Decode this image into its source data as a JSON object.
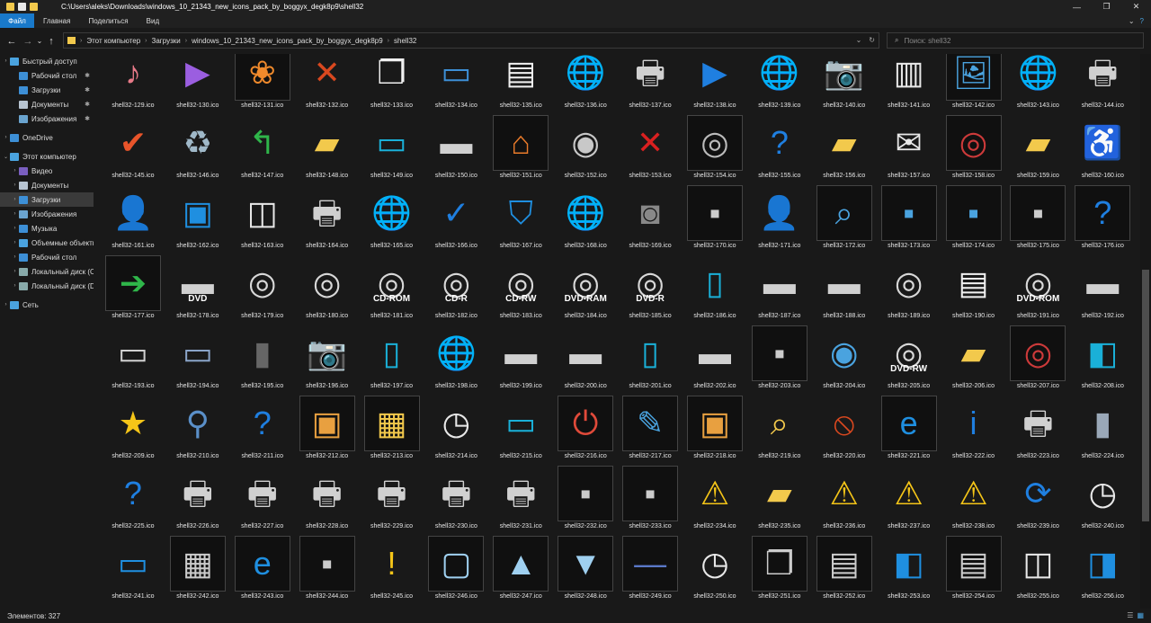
{
  "window": {
    "title": "C:\\Users\\aleks\\Downloads\\windows_10_21343_new_icons_pack_by_boggyx_degk8p9\\shell32",
    "minimize": "—",
    "maximize": "❐",
    "close": "✕"
  },
  "ribbon": {
    "tabs": [
      "Файл",
      "Главная",
      "Поделиться",
      "Вид"
    ],
    "expand": "⌄",
    "help": "?"
  },
  "nav": {
    "back": "←",
    "forward": "→",
    "recent": "⌄",
    "up": "↑",
    "breadcrumb": [
      "Этот компьютер",
      "Загрузки",
      "windows_10_21343_new_icons_pack_by_boggyx_degk8p9",
      "shell32"
    ],
    "refresh": "↻",
    "dropdown": "⌄",
    "search_placeholder": "Поиск: shell32"
  },
  "sidebar": {
    "items": [
      {
        "label": "Быстрый доступ",
        "icon": "star",
        "color": "#4aa3df",
        "indent": 0,
        "expander": "›",
        "pinned": false
      },
      {
        "label": "Рабочий стол",
        "icon": "desktop",
        "color": "#3d8fd6",
        "indent": 1,
        "expander": "",
        "pinned": true
      },
      {
        "label": "Загрузки",
        "icon": "download",
        "color": "#3d8fd6",
        "indent": 1,
        "expander": "",
        "pinned": true
      },
      {
        "label": "Документы",
        "icon": "document",
        "color": "#b7c4d1",
        "indent": 1,
        "expander": "",
        "pinned": true
      },
      {
        "label": "Изображения",
        "icon": "pictures",
        "color": "#6aa4cf",
        "indent": 1,
        "expander": "",
        "pinned": true
      },
      {
        "gap": true
      },
      {
        "label": "OneDrive",
        "icon": "cloud",
        "color": "#3d8fd6",
        "indent": 0,
        "expander": "›",
        "pinned": false
      },
      {
        "gap": true
      },
      {
        "label": "Этот компьютер",
        "icon": "computer",
        "color": "#4aa3df",
        "indent": 0,
        "expander": "⌄",
        "pinned": false
      },
      {
        "label": "Видео",
        "icon": "video",
        "color": "#7a5fc0",
        "indent": 1,
        "expander": "›",
        "pinned": false
      },
      {
        "label": "Документы",
        "icon": "document",
        "color": "#b7c4d1",
        "indent": 1,
        "expander": "›",
        "pinned": false
      },
      {
        "label": "Загрузки",
        "icon": "download",
        "color": "#3d8fd6",
        "indent": 1,
        "expander": "›",
        "pinned": false,
        "selected": true
      },
      {
        "label": "Изображения",
        "icon": "pictures",
        "color": "#6aa4cf",
        "indent": 1,
        "expander": "›",
        "pinned": false
      },
      {
        "label": "Музыка",
        "icon": "music",
        "color": "#3d8fd6",
        "indent": 1,
        "expander": "›",
        "pinned": false
      },
      {
        "label": "Объемные объекты",
        "icon": "3d",
        "color": "#4aa3df",
        "indent": 1,
        "expander": "›",
        "pinned": false
      },
      {
        "label": "Рабочий стол",
        "icon": "desktop",
        "color": "#3d8fd6",
        "indent": 1,
        "expander": "›",
        "pinned": false
      },
      {
        "label": "Локальный диск (C:)",
        "icon": "drive",
        "color": "#8aa",
        "indent": 1,
        "expander": "›",
        "pinned": false
      },
      {
        "label": "Локальный диск (D:)",
        "icon": "drive",
        "color": "#8aa",
        "indent": 1,
        "expander": "›",
        "pinned": false
      },
      {
        "gap": true
      },
      {
        "label": "Сеть",
        "icon": "network",
        "color": "#4aa3df",
        "indent": 0,
        "expander": "›",
        "pinned": false
      }
    ]
  },
  "files": [
    {
      "name": "shell32-129.ico",
      "icon": "music-folder",
      "glyph": "♪",
      "color": "#e77a88"
    },
    {
      "name": "shell32-130.ico",
      "icon": "video-folder",
      "glyph": "▶",
      "color": "#9b5ee0"
    },
    {
      "name": "shell32-131.ico",
      "icon": "butterfly",
      "glyph": "❀",
      "color": "#f08a2c",
      "frame": true
    },
    {
      "name": "shell32-132.ico",
      "icon": "red-x",
      "glyph": "✕",
      "color": "#d9481f"
    },
    {
      "name": "shell32-133.ico",
      "icon": "copy-document",
      "glyph": "❐",
      "color": "#f0f0f0"
    },
    {
      "name": "shell32-134.ico",
      "icon": "text-select",
      "glyph": "▭",
      "color": "#3d8fd6"
    },
    {
      "name": "shell32-135.ico",
      "icon": "documents",
      "glyph": "▤",
      "color": "#f0f0f0"
    },
    {
      "name": "shell32-136.ico",
      "icon": "globe-arrow",
      "glyph": "🌐",
      "color": "#4aa3df"
    },
    {
      "name": "shell32-137.ico",
      "icon": "printer",
      "glyph": "🖶",
      "color": "#d0d0d0"
    },
    {
      "name": "shell32-138.ico",
      "icon": "play",
      "glyph": "▶",
      "color": "#1f7fe0"
    },
    {
      "name": "shell32-139.ico",
      "icon": "globe-music",
      "glyph": "🌐",
      "color": "#4aa3df"
    },
    {
      "name": "shell32-140.ico",
      "icon": "camera",
      "glyph": "📷",
      "color": "#cfcfcf"
    },
    {
      "name": "shell32-141.ico",
      "icon": "projector-screen",
      "glyph": "▥",
      "color": "#e8e8e8"
    },
    {
      "name": "shell32-142.ico",
      "icon": "image-file",
      "glyph": "🖼",
      "color": "#4aa3df",
      "frame": true
    },
    {
      "name": "shell32-143.ico",
      "icon": "globe-picture",
      "glyph": "🌐",
      "color": "#4aa3df"
    },
    {
      "name": "shell32-144.ico",
      "icon": "printer-picture",
      "glyph": "🖶",
      "color": "#d0d0d0"
    },
    {
      "name": "shell32-145.ico",
      "icon": "checkmark",
      "glyph": "✔",
      "color": "#e8542a"
    },
    {
      "name": "shell32-146.ico",
      "icon": "recycle-bin",
      "glyph": "♻",
      "color": "#9fb8c8"
    },
    {
      "name": "shell32-147.ico",
      "icon": "green-arrow",
      "glyph": "↰",
      "color": "#2fb64a"
    },
    {
      "name": "shell32-148.ico",
      "icon": "folder-warning",
      "glyph": "▰",
      "color": "#f2c94c"
    },
    {
      "name": "shell32-149.ico",
      "icon": "monitor-green",
      "glyph": "▭",
      "color": "#1ab0d8"
    },
    {
      "name": "shell32-150.ico",
      "icon": "drive",
      "glyph": "▬",
      "color": "#d0d0d0"
    },
    {
      "name": "shell32-151.ico",
      "icon": "network-home",
      "glyph": "⌂",
      "color": "#e87a2a",
      "frame": true
    },
    {
      "name": "shell32-152.ico",
      "icon": "disc-speaker",
      "glyph": "◉",
      "color": "#c8c8c8"
    },
    {
      "name": "shell32-153.ico",
      "icon": "document-x",
      "glyph": "✕",
      "color": "#d92020"
    },
    {
      "name": "shell32-154.ico",
      "icon": "cd",
      "glyph": "◎",
      "color": "#bbbbbb",
      "frame": true
    },
    {
      "name": "shell32-155.ico",
      "icon": "help-circle",
      "glyph": "?",
      "color": "#1f7fe0"
    },
    {
      "name": "shell32-156.ico",
      "icon": "folder",
      "glyph": "▰",
      "color": "#f2c94c"
    },
    {
      "name": "shell32-157.ico",
      "icon": "envelope",
      "glyph": "✉",
      "color": "#e8e8e8"
    },
    {
      "name": "shell32-158.ico",
      "icon": "cd-red",
      "glyph": "◎",
      "color": "#cc3a3a",
      "frame": true
    },
    {
      "name": "shell32-159.ico",
      "icon": "folder-users",
      "glyph": "▰",
      "color": "#f2c94c"
    },
    {
      "name": "shell32-160.ico",
      "icon": "accessibility",
      "glyph": "♿",
      "color": "#1f7fe0"
    },
    {
      "name": "shell32-161.ico",
      "icon": "user",
      "glyph": "👤",
      "color": "#1aa390"
    },
    {
      "name": "shell32-162.ico",
      "icon": "monitor-windows",
      "glyph": "▣",
      "color": "#1f8fe0"
    },
    {
      "name": "shell32-163.ico",
      "icon": "window-cd",
      "glyph": "◫",
      "color": "#e8e8e8"
    },
    {
      "name": "shell32-164.ico",
      "icon": "printer-speaker",
      "glyph": "🖶",
      "color": "#d0d0d0"
    },
    {
      "name": "shell32-165.ico",
      "icon": "globe-monitor",
      "glyph": "🌐",
      "color": "#4aa3df"
    },
    {
      "name": "shell32-166.ico",
      "icon": "check-window",
      "glyph": "✓",
      "color": "#1f7fe0"
    },
    {
      "name": "shell32-167.ico",
      "icon": "shield",
      "glyph": "⛉",
      "color": "#1f8fe0"
    },
    {
      "name": "shell32-168.ico",
      "icon": "globe-clock",
      "glyph": "🌐",
      "color": "#4aa3df"
    },
    {
      "name": "shell32-169.ico",
      "icon": "speaker-box",
      "glyph": "◙",
      "color": "#888888"
    },
    {
      "name": "shell32-170.ico",
      "icon": "small-image",
      "glyph": "▪",
      "color": "#cccccc",
      "frame": true
    },
    {
      "name": "shell32-171.ico",
      "icon": "user",
      "glyph": "👤",
      "color": "#1aa390"
    },
    {
      "name": "shell32-172.ico",
      "icon": "magnifier-window",
      "glyph": "⌕",
      "color": "#4aa3df",
      "frame": true
    },
    {
      "name": "shell32-173.ico",
      "icon": "computer-chat",
      "glyph": "▪",
      "color": "#4aa3df",
      "frame": true
    },
    {
      "name": "shell32-174.ico",
      "icon": "computer-keyboard",
      "glyph": "▪",
      "color": "#4aa3df",
      "frame": true
    },
    {
      "name": "shell32-175.ico",
      "icon": "monitor",
      "glyph": "▪",
      "color": "#cccccc",
      "frame": true
    },
    {
      "name": "shell32-176.ico",
      "icon": "help-window",
      "glyph": "?",
      "color": "#1f7fe0",
      "frame": true
    },
    {
      "name": "shell32-177.ico",
      "icon": "run-arrow",
      "glyph": "➔",
      "color": "#2fb64a",
      "frame": true
    },
    {
      "name": "shell32-178.ico",
      "icon": "dvd-drive",
      "glyph": "▬",
      "color": "#d0d0d0",
      "caption": "DVD"
    },
    {
      "name": "shell32-179.ico",
      "icon": "music-cd",
      "glyph": "◎",
      "color": "#d8d8d8"
    },
    {
      "name": "shell32-180.ico",
      "icon": "cd-help",
      "glyph": "◎",
      "color": "#d8d8d8"
    },
    {
      "name": "shell32-181.ico",
      "icon": "cd-rom",
      "glyph": "◎",
      "color": "#d8d8d8",
      "caption": "CD-ROM"
    },
    {
      "name": "shell32-182.ico",
      "icon": "cd-r",
      "glyph": "◎",
      "color": "#d8d8d8",
      "caption": "CD-R"
    },
    {
      "name": "shell32-183.ico",
      "icon": "cd-rw",
      "glyph": "◎",
      "color": "#d8d8d8",
      "caption": "CD-RW"
    },
    {
      "name": "shell32-184.ico",
      "icon": "dvd-ram",
      "glyph": "◎",
      "color": "#d8d8d8",
      "caption": "DVD-RAM"
    },
    {
      "name": "shell32-185.ico",
      "icon": "dvd-r",
      "glyph": "◎",
      "color": "#d8d8d8",
      "caption": "DVD-R"
    },
    {
      "name": "shell32-186.ico",
      "icon": "phone",
      "glyph": "▯",
      "color": "#1ab0d8"
    },
    {
      "name": "shell32-187.ico",
      "icon": "drive-label",
      "glyph": "▬",
      "color": "#d0d0d0"
    },
    {
      "name": "shell32-188.ico",
      "icon": "drive-floppy",
      "glyph": "▬",
      "color": "#d0d0d0"
    },
    {
      "name": "shell32-189.ico",
      "icon": "cd",
      "glyph": "◎",
      "color": "#d8d8d8"
    },
    {
      "name": "shell32-190.ico",
      "icon": "document-book",
      "glyph": "▤",
      "color": "#f0f0f0"
    },
    {
      "name": "shell32-191.ico",
      "icon": "dvd-rom",
      "glyph": "◎",
      "color": "#d8d8d8",
      "caption": "DVD-ROM"
    },
    {
      "name": "shell32-192.ico",
      "icon": "drive",
      "glyph": "▬",
      "color": "#d0d0d0"
    },
    {
      "name": "shell32-193.ico",
      "icon": "drive-bay",
      "glyph": "▭",
      "color": "#d0d0d0"
    },
    {
      "name": "shell32-194.ico",
      "icon": "card-reader",
      "glyph": "▭",
      "color": "#8aa4c8"
    },
    {
      "name": "shell32-195.ico",
      "icon": "sd-card",
      "glyph": "▮",
      "color": "#666666"
    },
    {
      "name": "shell32-196.ico",
      "icon": "camera",
      "glyph": "📷",
      "color": "#cfcfcf"
    },
    {
      "name": "shell32-197.ico",
      "icon": "tablet",
      "glyph": "▯",
      "color": "#1ab0d8"
    },
    {
      "name": "shell32-198.ico",
      "icon": "globe-printer",
      "glyph": "🌐",
      "color": "#4aa3df"
    },
    {
      "name": "shell32-199.ico",
      "icon": "scanner-drive",
      "glyph": "▬",
      "color": "#d0d0d0"
    },
    {
      "name": "shell32-200.ico",
      "icon": "drive-card",
      "glyph": "▬",
      "color": "#d0d0d0"
    },
    {
      "name": "shell32-201.ico",
      "icon": "tablet-keyboard",
      "glyph": "▯",
      "color": "#1ab0d8"
    },
    {
      "name": "shell32-202.ico",
      "icon": "scanner",
      "glyph": "▬",
      "color": "#d0d0d0"
    },
    {
      "name": "shell32-203.ico",
      "icon": "camera-device",
      "glyph": "▪",
      "color": "#cccccc",
      "frame": true
    },
    {
      "name": "shell32-204.ico",
      "icon": "webcam-monitor",
      "glyph": "◉",
      "color": "#4aa3df"
    },
    {
      "name": "shell32-205.ico",
      "icon": "dvd-rw",
      "glyph": "◎",
      "color": "#d8d8d8",
      "caption": "DVD-RW"
    },
    {
      "name": "shell32-206.ico",
      "icon": "folder",
      "glyph": "▰",
      "color": "#f2c94c"
    },
    {
      "name": "shell32-207.ico",
      "icon": "cd-red",
      "glyph": "◎",
      "color": "#cc3a3a",
      "frame": true
    },
    {
      "name": "shell32-208.ico",
      "icon": "control-panel",
      "glyph": "◧",
      "color": "#1ab0d8"
    },
    {
      "name": "shell32-209.ico",
      "icon": "star",
      "glyph": "★",
      "color": "#f5c518"
    },
    {
      "name": "shell32-210.ico",
      "icon": "magnifier",
      "glyph": "⚲",
      "color": "#5a8fc8"
    },
    {
      "name": "shell32-211.ico",
      "icon": "help-circle",
      "glyph": "?",
      "color": "#1f7fe0"
    },
    {
      "name": "shell32-212.ico",
      "icon": "key-box",
      "glyph": "▣",
      "color": "#e8a040",
      "frame": true
    },
    {
      "name": "shell32-213.ico",
      "icon": "calendar-folder",
      "glyph": "▦",
      "color": "#f2c94c",
      "frame": true
    },
    {
      "name": "shell32-214.ico",
      "icon": "clock-document",
      "glyph": "◷",
      "color": "#e8e8e8"
    },
    {
      "name": "shell32-215.ico",
      "icon": "window-frame",
      "glyph": "▭",
      "color": "#1ab0d8"
    },
    {
      "name": "shell32-216.ico",
      "icon": "power-box",
      "glyph": "⏻",
      "color": "#e04a3a",
      "frame": true
    },
    {
      "name": "shell32-217.ico",
      "icon": "edit-document",
      "glyph": "✎",
      "color": "#4aa3df",
      "frame": true
    },
    {
      "name": "shell32-218.ico",
      "icon": "file-box",
      "glyph": "▣",
      "color": "#e8a040",
      "frame": true
    },
    {
      "name": "shell32-219.ico",
      "icon": "folder-search",
      "glyph": "⌕",
      "color": "#f2c94c"
    },
    {
      "name": "shell32-220.ico",
      "icon": "prohibited",
      "glyph": "⦸",
      "color": "#d9481f"
    },
    {
      "name": "shell32-221.ico",
      "icon": "internet-explorer",
      "glyph": "e",
      "color": "#1f8fe0",
      "frame": true
    },
    {
      "name": "shell32-222.ico",
      "icon": "info",
      "glyph": "i",
      "color": "#1f7fe0"
    },
    {
      "name": "shell32-223.ico",
      "icon": "printer-check",
      "glyph": "🖶",
      "color": "#d0d0d0"
    },
    {
      "name": "shell32-224.ico",
      "icon": "server-check",
      "glyph": "▮",
      "color": "#9aa8b8"
    },
    {
      "name": "shell32-225.ico",
      "icon": "help-document",
      "glyph": "?",
      "color": "#1f7fe0"
    },
    {
      "name": "shell32-226.ico",
      "icon": "printer",
      "glyph": "🖶",
      "color": "#d0d0d0"
    },
    {
      "name": "shell32-227.ico",
      "icon": "printer-search",
      "glyph": "🖶",
      "color": "#d0d0d0"
    },
    {
      "name": "shell32-228.ico",
      "icon": "printer-edit",
      "glyph": "🖶",
      "color": "#d0d0d0"
    },
    {
      "name": "shell32-229.ico",
      "icon": "printer-network",
      "glyph": "🖶",
      "color": "#d0d0d0"
    },
    {
      "name": "shell32-230.ico",
      "icon": "printer-network",
      "glyph": "🖶",
      "color": "#d0d0d0"
    },
    {
      "name": "shell32-231.ico",
      "icon": "printer-users",
      "glyph": "🖶",
      "color": "#d0d0d0"
    },
    {
      "name": "shell32-232.ico",
      "icon": "fax",
      "glyph": "▪",
      "color": "#cccccc",
      "frame": true
    },
    {
      "name": "shell32-233.ico",
      "icon": "computer-old",
      "glyph": "▪",
      "color": "#cccccc",
      "frame": true
    },
    {
      "name": "shell32-234.ico",
      "icon": "warning",
      "glyph": "⚠",
      "color": "#f5c518"
    },
    {
      "name": "shell32-235.ico",
      "icon": "folder-x",
      "glyph": "▰",
      "color": "#f2c94c"
    },
    {
      "name": "shell32-236.ico",
      "icon": "warning",
      "glyph": "⚠",
      "color": "#f5c518"
    },
    {
      "name": "shell32-237.ico",
      "icon": "warning",
      "glyph": "⚠",
      "color": "#f5c518"
    },
    {
      "name": "shell32-238.ico",
      "icon": "warning",
      "glyph": "⚠",
      "color": "#f5c518"
    },
    {
      "name": "shell32-239.ico",
      "icon": "sync",
      "glyph": "⟳",
      "color": "#1f7fe0"
    },
    {
      "name": "shell32-240.ico",
      "icon": "clock-arrow",
      "glyph": "◷",
      "color": "#e8e8e8"
    },
    {
      "name": "shell32-241.ico",
      "icon": "window",
      "glyph": "▭",
      "color": "#1f8fe0"
    },
    {
      "name": "shell32-242.ico",
      "icon": "pictures",
      "glyph": "▦",
      "color": "#cccccc",
      "frame": true
    },
    {
      "name": "shell32-243.ico",
      "icon": "internet-explorer",
      "glyph": "e",
      "color": "#1f8fe0",
      "frame": true
    },
    {
      "name": "shell32-244.ico",
      "icon": "usb",
      "glyph": "▪",
      "color": "#cccccc",
      "frame": true
    },
    {
      "name": "shell32-245.ico",
      "icon": "shield-warning",
      "glyph": "!",
      "color": "#f5c518"
    },
    {
      "name": "shell32-246.ico",
      "icon": "blank-window",
      "glyph": "▢",
      "color": "#9fd0f0",
      "frame": true
    },
    {
      "name": "shell32-247.ico",
      "icon": "arrow-up",
      "glyph": "▲",
      "color": "#9fd0f0",
      "frame": true
    },
    {
      "name": "shell32-248.ico",
      "icon": "arrow-down",
      "glyph": "▼",
      "color": "#9fd0f0",
      "frame": true
    },
    {
      "name": "shell32-249.ico",
      "icon": "minimize-line",
      "glyph": "—",
      "color": "#5a78c8",
      "frame": true
    },
    {
      "name": "shell32-250.ico",
      "icon": "clock",
      "glyph": "◷",
      "color": "#e8e8e8"
    },
    {
      "name": "shell32-251.ico",
      "icon": "cascade-windows",
      "glyph": "❐",
      "color": "#cccccc",
      "frame": true
    },
    {
      "name": "shell32-252.ico",
      "icon": "tile-windows",
      "glyph": "▤",
      "color": "#cccccc",
      "frame": true
    },
    {
      "name": "shell32-253.ico",
      "icon": "split-window",
      "glyph": "◧",
      "color": "#1f8fe0"
    },
    {
      "name": "shell32-254.ico",
      "icon": "document-small",
      "glyph": "▤",
      "color": "#cccccc",
      "frame": true
    },
    {
      "name": "shell32-255.ico",
      "icon": "panes",
      "glyph": "◫",
      "color": "#e8e8e8"
    },
    {
      "name": "shell32-256.ico",
      "icon": "panes-blue",
      "glyph": "◨",
      "color": "#1f8fe0"
    }
  ],
  "status": {
    "item_count": "Элементов: 327"
  }
}
